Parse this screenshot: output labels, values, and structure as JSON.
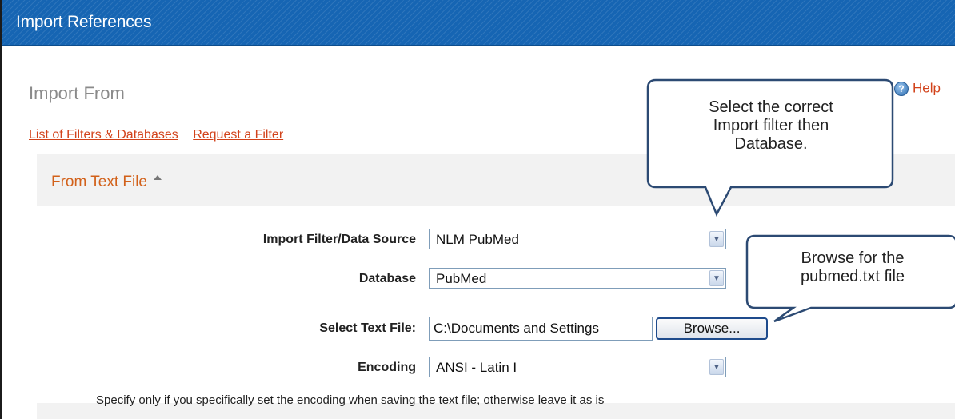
{
  "window": {
    "title": "Import References"
  },
  "header": {
    "import_from": "Import From",
    "help": "Help"
  },
  "links": {
    "filters": "List of Filters & Databases",
    "request": "Request a Filter"
  },
  "section": {
    "title": "From Text File"
  },
  "form": {
    "filter_label": "Import Filter/Data Source",
    "filter_value": "NLM PubMed",
    "database_label": "Database",
    "database_value": "PubMed",
    "file_label": "Select Text File:",
    "file_value": "C:\\Documents and Settings",
    "browse": "Browse...",
    "encoding_label": "Encoding",
    "encoding_value": "ANSI - Latin I",
    "note": "Specify only if you specifically set the encoding when saving the text file; otherwise leave it as is"
  },
  "callouts": {
    "filter_tip": [
      "Select the correct",
      "Import filter then",
      "Database."
    ],
    "browse_tip": [
      "Browse for the",
      "pubmed.txt file"
    ]
  },
  "colors": {
    "titlebar": "#1665b3",
    "link": "#d2421a",
    "section_title": "#d2611a",
    "callout_fill": "#ffffff",
    "callout_border": "#2c4a73"
  }
}
